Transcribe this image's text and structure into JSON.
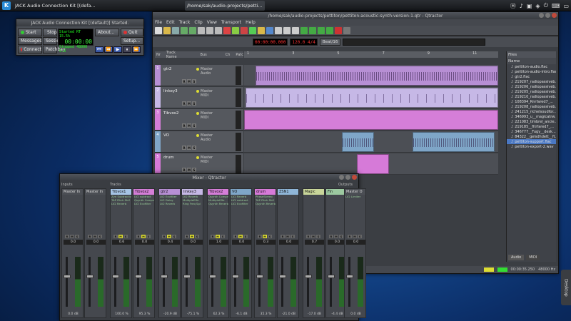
{
  "taskbar": {
    "items": [
      {
        "label": "JACK Audio Connection Kit [(defa..."
      },
      {
        "label": "/home/sak/audio-projects/petti..."
      }
    ]
  },
  "jack": {
    "title": "JACK Audio Connection Kit [(default)] Started.",
    "buttons": {
      "start": "Start",
      "stop": "Stop",
      "quit": "Quit",
      "messages": "Messages",
      "session": "Session",
      "setup": "Setup...",
      "connect": "Connect",
      "patchbay": "Patchbay",
      "about": "About..."
    },
    "display": {
      "status": "Started",
      "rt": "RT",
      "dsp": "15.5%",
      "rate": "48000",
      "time": "00:00:00",
      "stopped": "Stopped",
      "latency": "5.8"
    }
  },
  "qtractor": {
    "title": "/home/sak/audio-projects/pettiton/pettiton-acoustic-synth-version-1.qtr - Qtractor",
    "menu": [
      "File",
      "Edit",
      "Track",
      "Clip",
      "View",
      "Transport",
      "Help"
    ],
    "time_display": "00:00:00.000",
    "tempo_display": "120.0 4/4",
    "snap": "Beat/16",
    "track_header": [
      "Nr",
      "Track Name",
      "Bus",
      "Ch",
      "Patc"
    ],
    "tracks": [
      {
        "nr": "1",
        "name": "gtr2",
        "bus": "Master\nAudio",
        "color": "#b78fd4"
      },
      {
        "nr": "2",
        "name": "linkey3",
        "bus": "Master\nMIDI",
        "color": "#c6b8e6"
      },
      {
        "nr": "3",
        "name": "Tibvox2",
        "bus": "Master\nMIDI",
        "color": "#d57ed8"
      },
      {
        "nr": "4",
        "name": "VO",
        "bus": "Master\nAudio",
        "color": "#7fa6c8"
      },
      {
        "nr": "5",
        "name": "drum",
        "bus": "Master\nMIDI",
        "color": "#d67ad8"
      }
    ],
    "ruler_marks": [
      "1",
      "3",
      "5",
      "7",
      "9",
      "11"
    ],
    "files": {
      "header": "Files",
      "col": "Name",
      "items": [
        "pettiton-audio.flac",
        "pettiton-audio-intro.flac",
        "gtr2.flac",
        "219207_radiopassiveb...",
        "219206_radiopassiveb...",
        "219205_radiopassiveb...",
        "219210_radiopassiveb...",
        "108394_Rnrfared7_...",
        "219208_radiopassiveb...",
        "241215_richelsoudfor...",
        "346993_u__magicatrw...",
        "221083_timbrel_ancie...",
        "219185__fitrfared7_...",
        "346777__Fugy__desk...",
        "84322__gelsdhdett__ft...",
        "pettiton-support.flac",
        "pettiton-export-2.wav"
      ],
      "selected_index": 15,
      "tabs": [
        "Audio",
        "MIDI"
      ]
    },
    "status": {
      "time": "00:00:35.250",
      "rate": "48000 Hz"
    }
  },
  "mixer": {
    "title": "Mixer - Qtractor",
    "panel_labels": {
      "inputs": "Inputs",
      "tracks": "Tracks",
      "outputs": "Outputs"
    },
    "strips": [
      {
        "name": "Master In",
        "color": "#4b4e54",
        "plugins": [],
        "val": "0.0",
        "db": "0.0 dB"
      },
      {
        "name": "Master In",
        "color": "#4b4e54",
        "plugins": [],
        "val": "0.0",
        "db": ""
      },
      {
        "name": "Tibvox1",
        "color": "#a6c4e6",
        "plugins": [
          "Zyn Subtractiv",
          "TAP Pitch Shif",
          "LV2 Reverb"
        ],
        "val": "0.6",
        "db": "100.0 %"
      },
      {
        "name": "Tibvox2",
        "color": "#d57ed8",
        "plugins": [
          "LV2 subtract",
          "Qsynth Compre",
          "LV2 Ecofilter"
        ],
        "val": "0.0",
        "db": "95.3 %"
      },
      {
        "name": "gtr2",
        "color": "#b78fd4",
        "plugins": [
          "LV2 Ecofilter",
          "LV2 Delay",
          "LV2 Reverb"
        ],
        "val": "0.4",
        "db": "-20.9 dB"
      },
      {
        "name": "linkey3",
        "color": "#c6b8e6",
        "plugins": [
          "LV2 Reverb",
          "MultipleEffe",
          "Ring Freq Spl"
        ],
        "val": "0.0",
        "db": "-75.1 %"
      },
      {
        "name": "Tibvox2",
        "color": "#d57ed8",
        "plugins": [
          "Qsynth Compre",
          "MultipleEffe",
          "Qsynth Reverb"
        ],
        "val": "1.0",
        "db": "62.3 %"
      },
      {
        "name": "VO",
        "color": "#7fa6c8",
        "plugins": [
          "LV2 Reverb",
          "LV2 subtract",
          "LV2 Ecofilter"
        ],
        "val": "0.0",
        "db": "-6.1 dB"
      },
      {
        "name": "drum",
        "color": "#d67ad8",
        "plugins": [
          "PhaseStereo",
          "TAP Pitch Shif",
          "Qsynth Reverb"
        ],
        "val": "0.3",
        "db": "35.3 %"
      },
      {
        "name": "ZSN1",
        "color": "#8fb6d8",
        "plugins": [],
        "val": "0.0",
        "db": "-21.0 dB"
      },
      {
        "name": "Magic",
        "color": "#c9d69a",
        "plugins": [],
        "val": "0.7",
        "db": "-17.0 dB"
      },
      {
        "name": "Fin",
        "color": "#9cc9a0",
        "plugins": [],
        "val": "0.0",
        "db": "-4.4 dB"
      },
      {
        "name": "Master O",
        "color": "#4b4e54",
        "plugins": [
          "LV2 Limiter"
        ],
        "val": "0.0",
        "db": "0.0 dB"
      }
    ]
  },
  "desktop_tab": "Desktop"
}
